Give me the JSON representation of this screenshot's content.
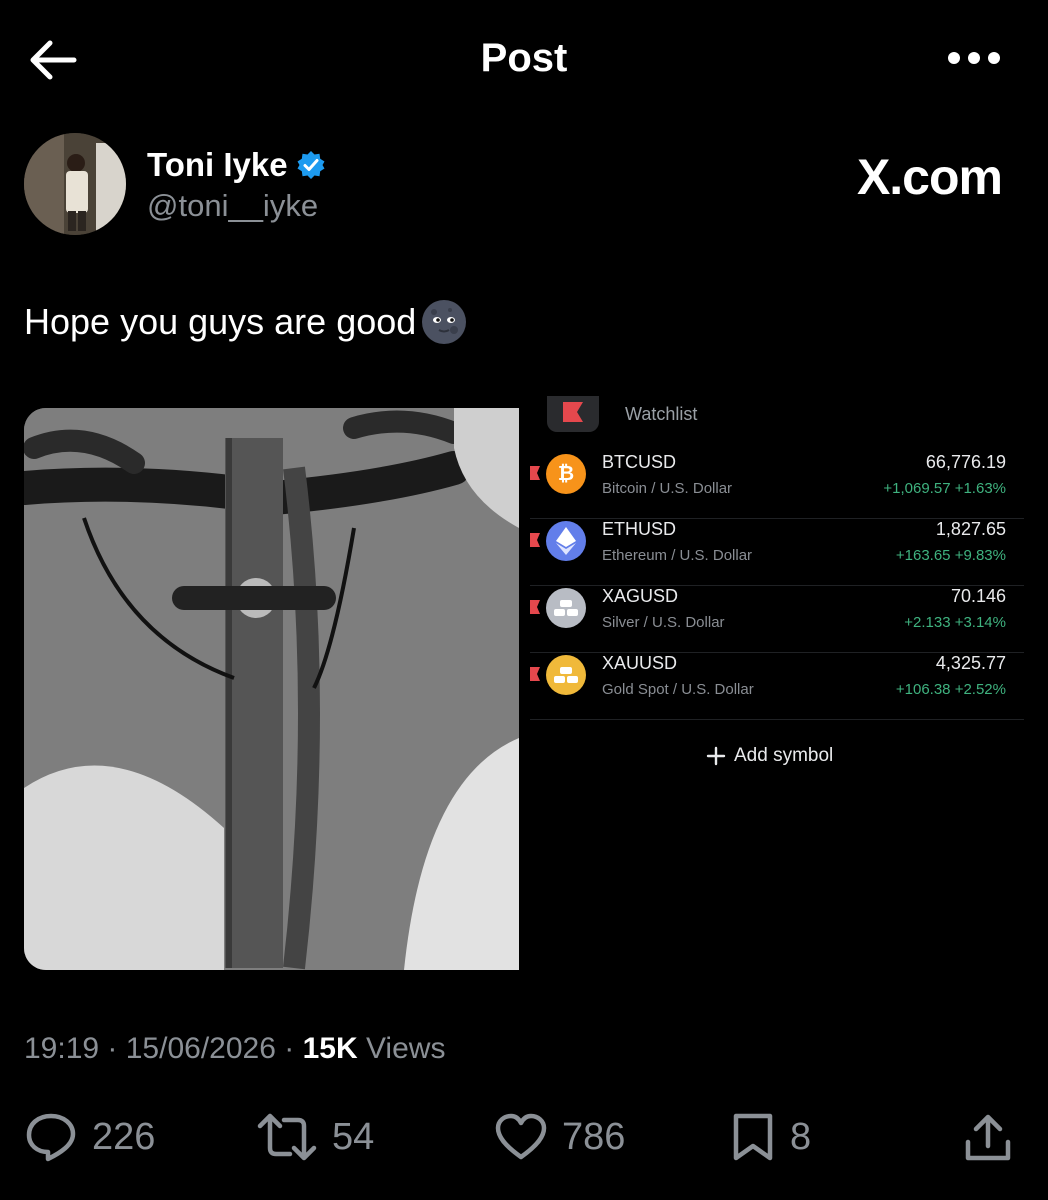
{
  "header": {
    "title": "Post"
  },
  "author": {
    "name": "Toni Iyke",
    "handle": "@toni__iyke"
  },
  "brand": "X.com",
  "post": {
    "text": "Hope you guys are good"
  },
  "watchlist": {
    "title": "Watchlist",
    "items": [
      {
        "symbol": "BTCUSD",
        "description": "Bitcoin / U.S. Dollar",
        "price": "66,776.19",
        "change": "+1,069.57  +1.63%",
        "icon_color": "#f7931a",
        "icon": "bitcoin-icon"
      },
      {
        "symbol": "ETHUSD",
        "description": "Ethereum / U.S. Dollar",
        "price": "1,827.65",
        "change": "+163.65  +9.83%",
        "icon_color": "#627eea",
        "icon": "ethereum-icon"
      },
      {
        "symbol": "XAGUSD",
        "description": "Silver / U.S. Dollar",
        "price": "70.146",
        "change": "+2.133  +3.14%",
        "icon_color": "#b8bcc4",
        "icon": "silver-bars-icon"
      },
      {
        "symbol": "XAUUSD",
        "description": "Gold Spot / U.S. Dollar",
        "price": "4,325.77",
        "change": "+106.38  +2.52%",
        "icon_color": "#f0b93a",
        "icon": "gold-bars-icon"
      }
    ],
    "add_label": "Add symbol"
  },
  "meta": {
    "time": "19:19",
    "date": "15/06/2026",
    "views_count": "15K",
    "views_label": "Views"
  },
  "actions": {
    "replies": "226",
    "reposts": "54",
    "likes": "786",
    "bookmarks": "8"
  }
}
